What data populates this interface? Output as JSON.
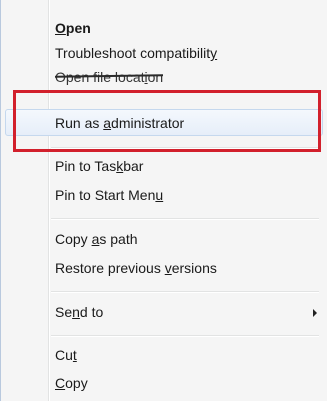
{
  "menu": {
    "items": [
      {
        "id": "open",
        "pre": "",
        "acc": "O",
        "post": "pen",
        "bold": true
      },
      {
        "id": "troubleshoot",
        "pre": "Troubleshoot compatibilit",
        "acc": "y",
        "post": ""
      },
      {
        "id": "open-file-location",
        "pre": "Open file locat",
        "acc": "i",
        "post": "on",
        "struck": true
      },
      {
        "id": "run-as-admin",
        "pre": "Run as ",
        "acc": "a",
        "post": "dministrator",
        "hover": true
      },
      {
        "id": "pin-taskbar",
        "pre": "Pin to Tas",
        "acc": "k",
        "post": "bar"
      },
      {
        "id": "pin-start",
        "pre": "Pin to Start Men",
        "acc": "u",
        "post": ""
      },
      {
        "id": "copy-as-path",
        "pre": "Copy ",
        "acc": "a",
        "post": "s path"
      },
      {
        "id": "restore-versions",
        "pre": "Restore previous ",
        "acc": "v",
        "post": "ersions"
      },
      {
        "id": "send-to",
        "pre": "Se",
        "acc": "n",
        "post": "d to",
        "submenu": true
      },
      {
        "id": "cut",
        "pre": "Cu",
        "acc": "t",
        "post": ""
      },
      {
        "id": "copy",
        "pre": "",
        "acc": "C",
        "post": "opy"
      }
    ]
  },
  "annotation": {
    "highlight_color": "#d2202c"
  }
}
